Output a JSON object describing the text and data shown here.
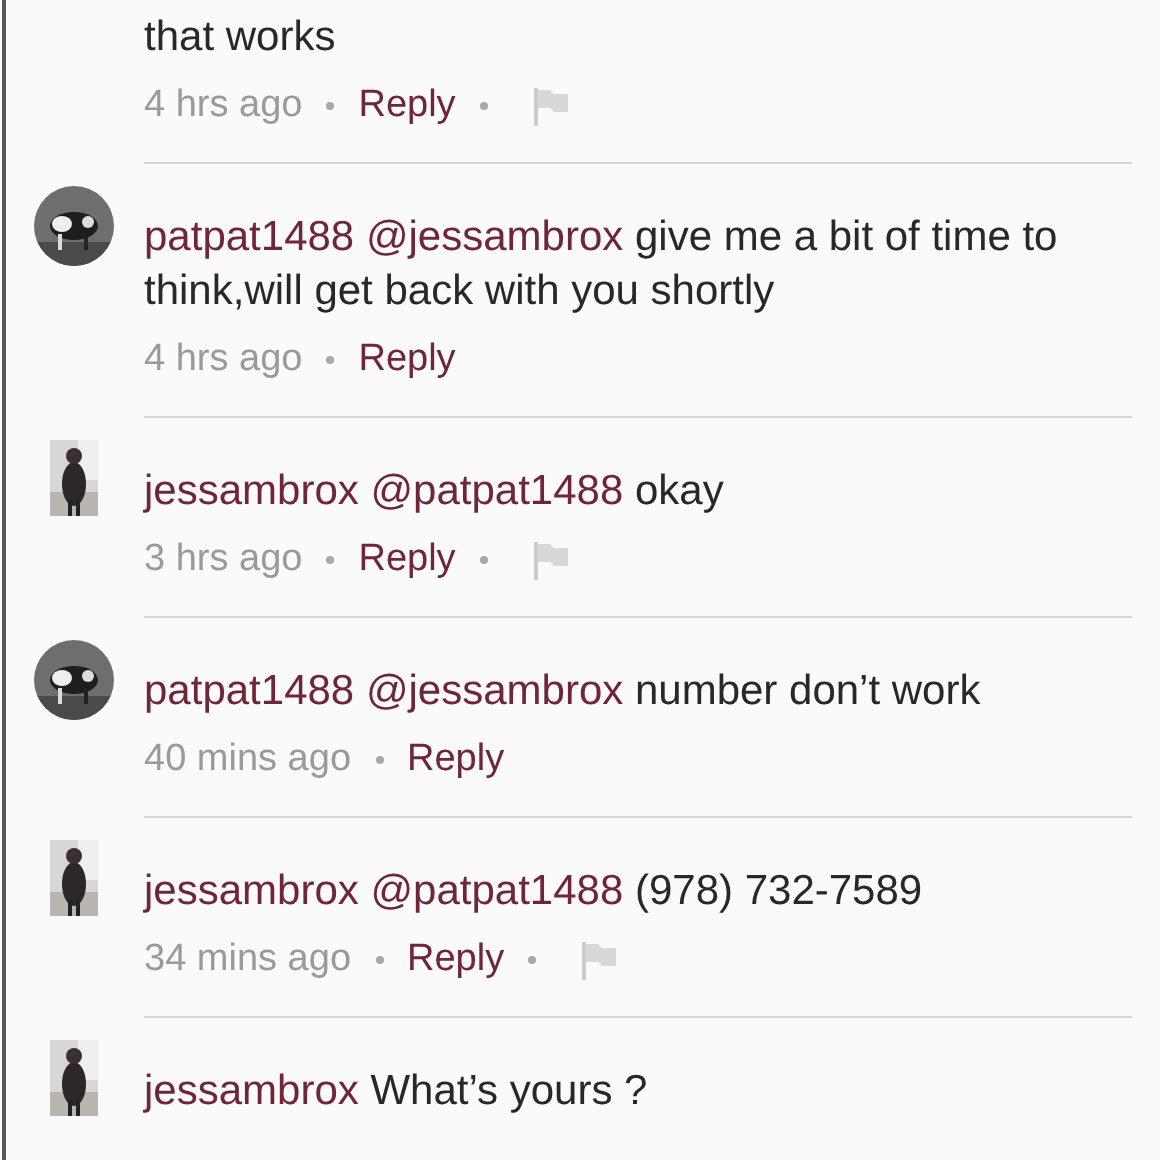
{
  "comments": [
    {
      "text": "that works",
      "time": "4 hrs ago",
      "reply": "Reply",
      "flaggable": true
    },
    {
      "author": "patpat1488",
      "round_avatar": true,
      "mention": "@jessambrox",
      "text": "give me a bit of time to think,will get back with you shortly",
      "time": "4 hrs ago",
      "reply": "Reply",
      "flaggable": false
    },
    {
      "author": "jessambrox",
      "round_avatar": false,
      "mention": "@patpat1488",
      "text": "okay",
      "time": "3 hrs ago",
      "reply": "Reply",
      "flaggable": true
    },
    {
      "author": "patpat1488",
      "round_avatar": true,
      "mention": "@jessambrox",
      "text": "number don’t work",
      "time": "40 mins ago",
      "reply": "Reply",
      "flaggable": false
    },
    {
      "author": "jessambrox",
      "round_avatar": false,
      "mention": "@patpat1488",
      "text": "(978) 732-7589",
      "time": "34 mins ago",
      "reply": "Reply",
      "flaggable": true
    },
    {
      "author": "jessambrox",
      "round_avatar": false,
      "text": "What’s yours ?"
    }
  ]
}
